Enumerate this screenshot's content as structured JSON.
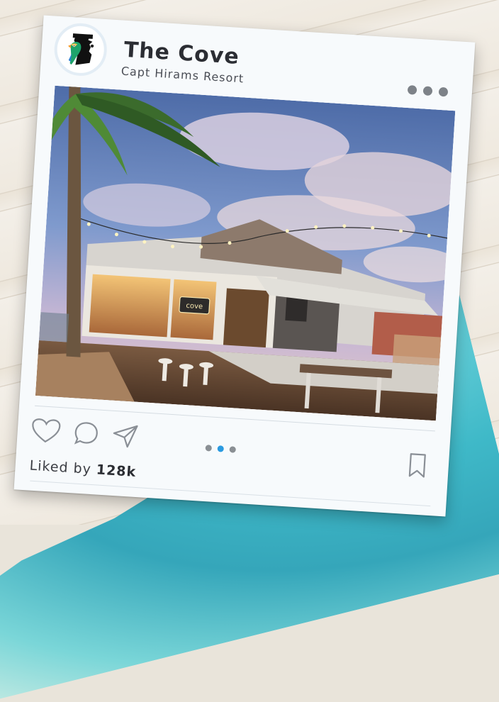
{
  "post": {
    "account_name": "The Cove",
    "account_subtitle": "Capt Hirams Resort",
    "liked_by_label": "Liked by",
    "likes_count": "128k",
    "carousel": {
      "total": 3,
      "active_index": 1
    },
    "photo_sign_text": "cove"
  },
  "colors": {
    "card_bg": "#f7fafc",
    "text_dark": "#2b2d33",
    "carousel_active": "#2a9ae0",
    "carousel_inactive": "#8a8f94"
  },
  "icons": [
    "more-options-icon",
    "heart-icon",
    "comment-icon",
    "share-icon",
    "bookmark-icon",
    "parrot-logo-icon"
  ]
}
